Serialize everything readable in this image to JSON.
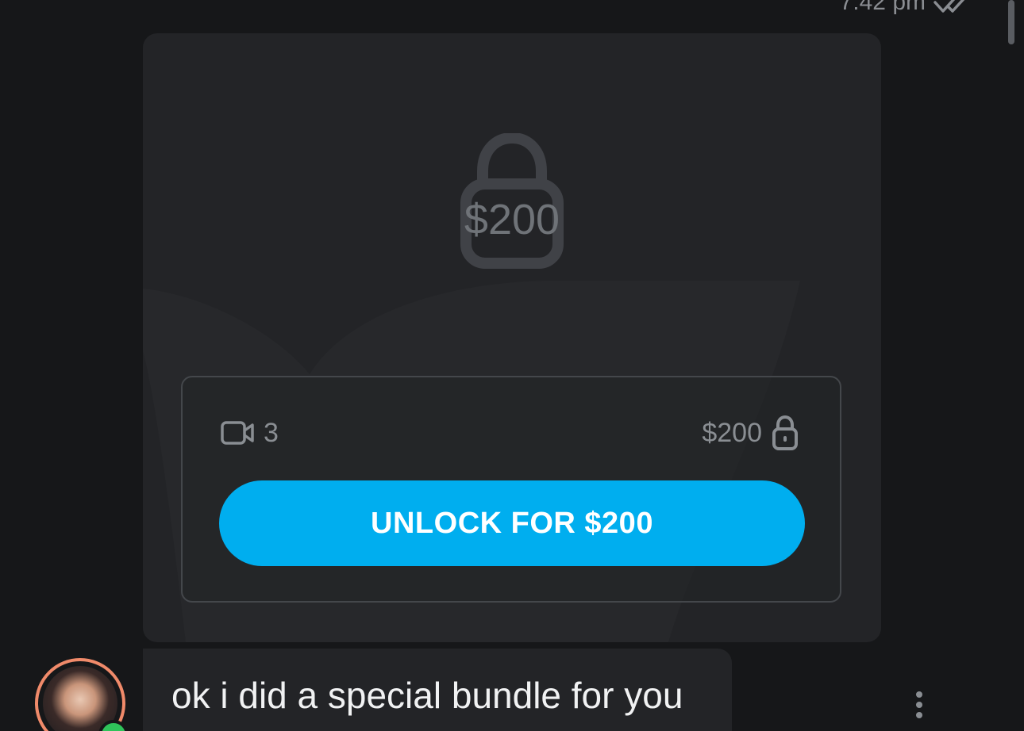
{
  "message_meta": {
    "time": "7:42 pm",
    "status_icon": "double-check-icon"
  },
  "locked_media": {
    "overlay_price": "$200",
    "lock_icon": "padlock-icon",
    "media_count": "3",
    "media_type_icon": "video-camera-icon",
    "price": "$200",
    "price_lock_icon": "padlock-icon",
    "unlock_button_label": "UNLOCK FOR $200"
  },
  "message": {
    "text": "ok i did a special bundle for you",
    "avatar_icon": "avatar",
    "online_indicator": "online-dot",
    "more_icon": "more-vertical-icon"
  },
  "colors": {
    "background": "#161719",
    "card": "#232427",
    "accent": "#00aeef",
    "muted_text": "#8a8e93",
    "online": "#2fc35a",
    "avatar_ring": "#f08a6a"
  }
}
